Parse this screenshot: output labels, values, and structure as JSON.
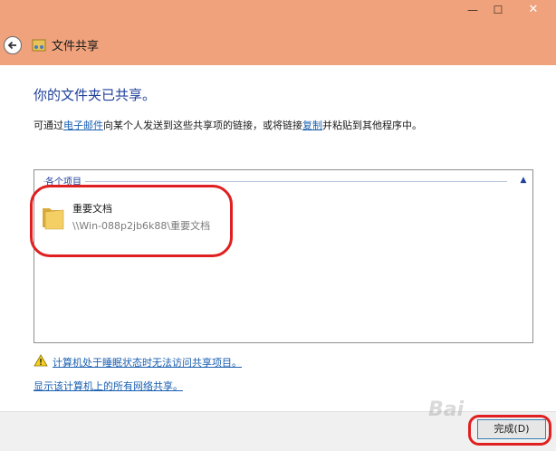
{
  "window": {
    "min_symbol": "—",
    "max_symbol": "☐",
    "close_symbol": "✕"
  },
  "nav": {
    "title": "文件共享"
  },
  "main": {
    "heading": "你的文件夹已共享。",
    "desc_part1": "可通过",
    "email_link": "电子邮件",
    "desc_part2": "向某个人发送到这些共享项的链接，或将链接",
    "copy_link": "复制",
    "desc_part3": "并粘贴到其他程序中。"
  },
  "items": {
    "group_label": "各个项目",
    "list": [
      {
        "name": "重要文档",
        "path": "\\\\Win-088p2jb6k88\\重要文档"
      }
    ]
  },
  "links": {
    "sleep_warning": "计算机处于睡眠状态时无法访问共享项目。",
    "all_shares": "显示该计算机上的所有网络共享。"
  },
  "footer": {
    "finish_label": "完成(D)"
  },
  "watermark": "Bai",
  "colors": {
    "titlebar": "#efa27b",
    "heading": "#1f3f9a",
    "link": "#1a5fb0",
    "highlight": "#e02020"
  },
  "icons": {
    "back": "back-arrow-icon",
    "wizard": "share-wizard-icon",
    "folder": "folder-icon",
    "warning": "warning-icon",
    "collapse": "chevron-up-icon"
  }
}
